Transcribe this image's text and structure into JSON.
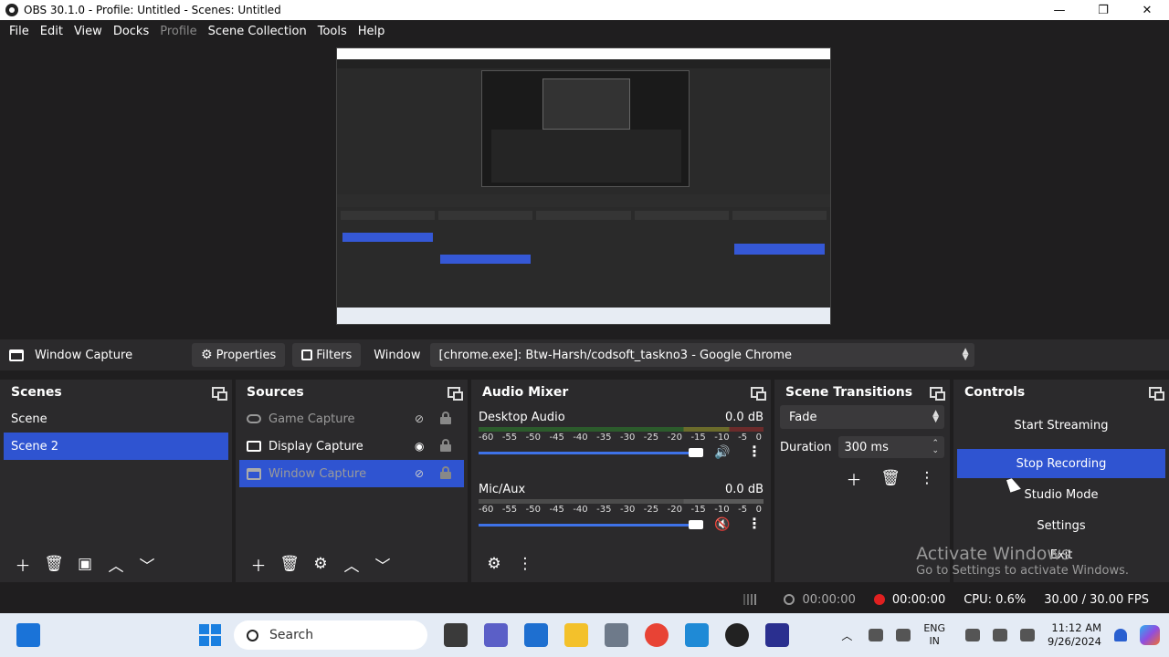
{
  "titlebar": {
    "title": "OBS 30.1.0 - Profile: Untitled - Scenes: Untitled",
    "minimize": "—",
    "maximize": "❐",
    "close": "✕"
  },
  "menu": [
    {
      "label": "File",
      "disabled": false
    },
    {
      "label": "Edit",
      "disabled": false
    },
    {
      "label": "View",
      "disabled": false
    },
    {
      "label": "Docks",
      "disabled": false
    },
    {
      "label": "Profile",
      "disabled": true
    },
    {
      "label": "Scene Collection",
      "disabled": false
    },
    {
      "label": "Tools",
      "disabled": false
    },
    {
      "label": "Help",
      "disabled": false
    }
  ],
  "source_toolbar": {
    "source_name": "Window Capture",
    "properties": "Properties",
    "filters": "Filters",
    "window_label": "Window",
    "window_value": "[chrome.exe]: Btw-Harsh/codsoft_taskno3 - Google Chrome"
  },
  "scenes": {
    "title": "Scenes",
    "items": [
      "Scene",
      "Scene 2"
    ],
    "selected": 1
  },
  "sources": {
    "title": "Sources",
    "items": [
      {
        "label": "Game Capture",
        "visible": false,
        "locked": true
      },
      {
        "label": "Display Capture",
        "visible": true,
        "locked": true
      },
      {
        "label": "Window Capture",
        "visible": false,
        "locked": true
      }
    ],
    "selected": 2
  },
  "audio": {
    "title": "Audio Mixer",
    "channels": [
      {
        "name": "Desktop Audio",
        "db": "0.0 dB",
        "muted": false,
        "volume": 1.0
      },
      {
        "name": "Mic/Aux",
        "db": "0.0 dB",
        "muted": true,
        "volume": 1.0
      }
    ],
    "scale": [
      "-60",
      "-55",
      "-50",
      "-45",
      "-40",
      "-35",
      "-30",
      "-25",
      "-20",
      "-15",
      "-10",
      "-5",
      "0"
    ]
  },
  "transitions": {
    "title": "Scene Transitions",
    "selected": "Fade",
    "duration_label": "Duration",
    "duration_value": "300 ms"
  },
  "controls": {
    "title": "Controls",
    "start_streaming": "Start Streaming",
    "stop_recording": "Stop Recording",
    "studio_mode": "Studio Mode",
    "settings": "Settings",
    "exit": "Exit"
  },
  "watermark": {
    "line1": "Activate Windows",
    "line2": "Go to Settings to activate Windows."
  },
  "status": {
    "stream_time": "00:00:00",
    "record_time": "00:00:00",
    "cpu": "CPU: 0.6%",
    "fps": "30.00 / 30.00 FPS"
  },
  "taskbar": {
    "search_placeholder": "Search",
    "lang_line1": "ENG",
    "lang_line2": "IN",
    "time": "11:12 AM",
    "date": "9/26/2024"
  },
  "colors": {
    "accent": "#2f54d1",
    "record": "#e02020",
    "panel": "#2b2a2c",
    "background": "#1f1e1f"
  }
}
